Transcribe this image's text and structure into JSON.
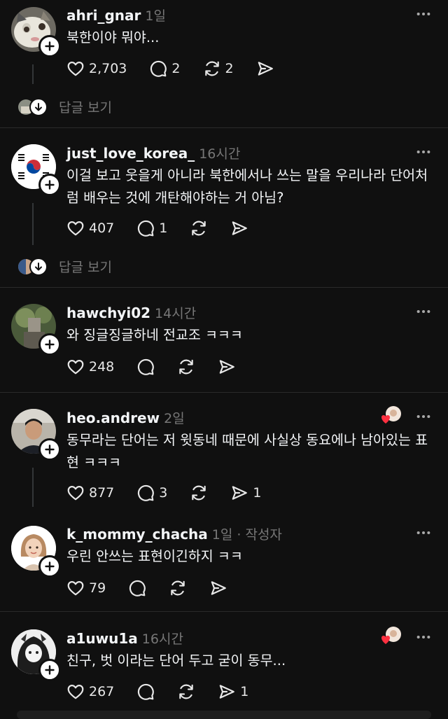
{
  "posts": [
    {
      "username": "ahri_gnar",
      "time": "1일",
      "text": "북한이야 뭐야...",
      "likes": "2,703",
      "comments": "2",
      "reposts": "2",
      "shares": "",
      "replies_label": "답글 보기"
    },
    {
      "username": "just_love_korea_",
      "time": "16시간",
      "text": "이걸 보고 웃을게 아니라 북한에서나 쓰는 말을 우리나라 단어처럼 배우는 것에 개탄해야하는 거 아님?",
      "likes": "407",
      "comments": "1",
      "reposts": "",
      "shares": "",
      "replies_label": "답글 보기"
    },
    {
      "username": "hawchyi02",
      "time": "14시간",
      "text": "와 징글징글하네 전교조 ㅋㅋㅋ",
      "likes": "248",
      "comments": "",
      "reposts": "",
      "shares": ""
    },
    {
      "username": "heo.andrew",
      "time": "2일",
      "text": "동무라는 단어는 저 윗동네 때문에 사실상 동요에나 남아있는 표현 ㅋㅋㅋ",
      "likes": "877",
      "comments": "3",
      "reposts": "",
      "shares": "1"
    },
    {
      "username": "k_mommy_chacha",
      "time": "1일 · 작성자",
      "text": "우린 안쓰는 표현이긴하지 ㅋㅋ",
      "likes": "79",
      "comments": "",
      "reposts": "",
      "shares": ""
    },
    {
      "username": "a1uwu1a",
      "time": "16시간",
      "text": "친구, 벗 이라는 단어 두고 굳이 동무...",
      "likes": "267",
      "comments": "",
      "reposts": "",
      "shares": "1"
    }
  ],
  "icons": {
    "like": "heart-icon",
    "comment": "comment-icon",
    "repost": "repost-icon",
    "share": "share-icon",
    "more": "more-icon",
    "follow": "plus-icon"
  },
  "colors": {
    "background": "#101010",
    "text": "#f3f5f7",
    "muted": "#777777",
    "heart": "#ff3040"
  }
}
